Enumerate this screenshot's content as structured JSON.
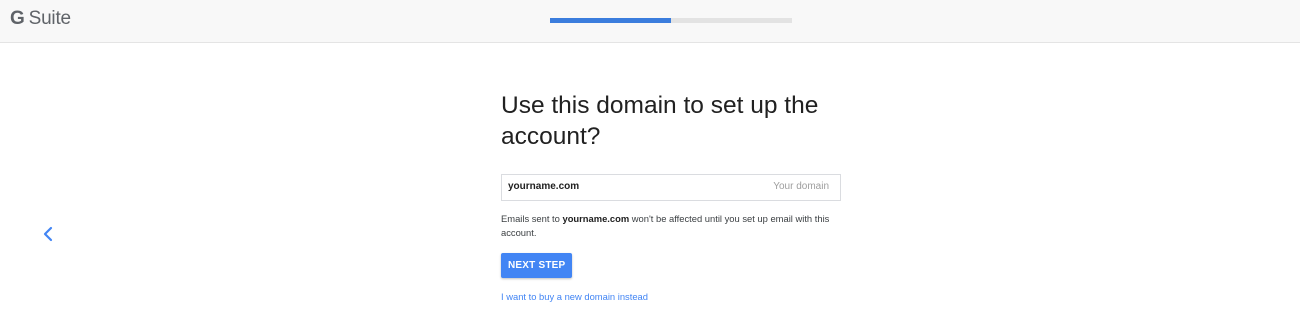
{
  "header": {
    "brand_g": "G",
    "brand_suite": "Suite",
    "progress_fraction": 0.5
  },
  "colors": {
    "accent": "#4285f4",
    "progress_fill": "#3b7ddd",
    "progress_track": "#e3e3e3",
    "header_bg": "#f8f8f8"
  },
  "main": {
    "title": "Use this domain to set up the account?",
    "domain_field": {
      "value": "yourname.com",
      "suffix_label": "Your domain"
    },
    "note": {
      "prefix": "Emails sent to ",
      "domain": "yourname.com",
      "suffix": " won't be affected until you set up email with this account."
    },
    "next_button_label": "NEXT STEP",
    "alt_link_label": "I want to buy a new domain instead"
  },
  "nav": {
    "back_icon": "chevron-left-icon"
  }
}
